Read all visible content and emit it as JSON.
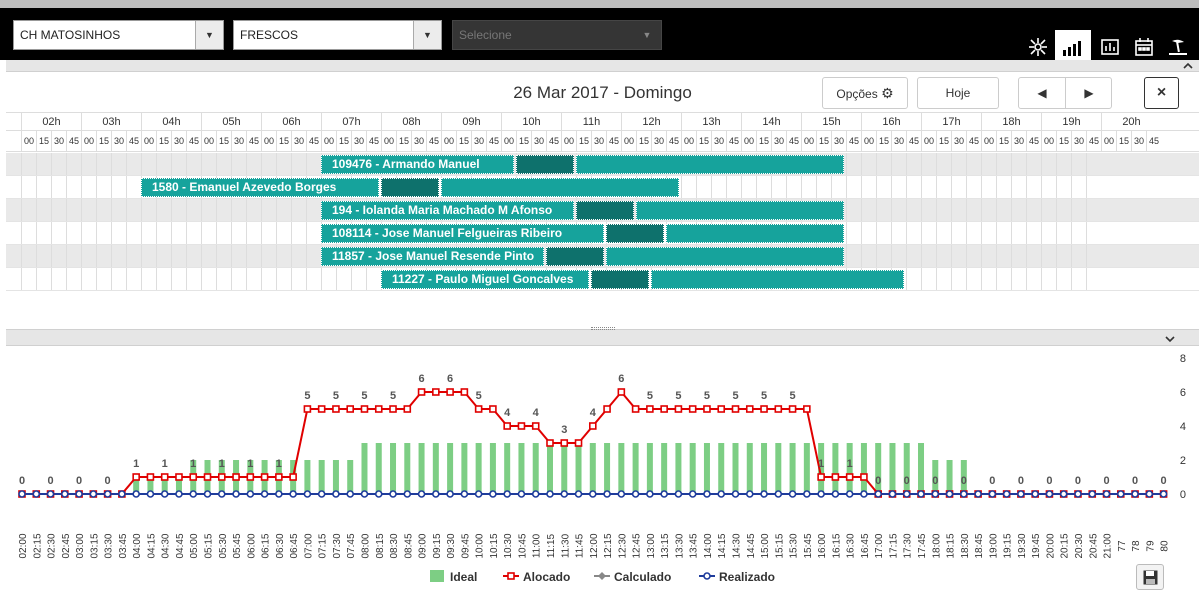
{
  "filters": {
    "store": "CH MATOSINHOS",
    "section": "FRESCOS",
    "third_placeholder": "Selecione"
  },
  "view_icons": [
    "network-icon",
    "bar-chart-icon",
    "column-chart-icon",
    "calendar-icon",
    "vacation-icon"
  ],
  "date_title": "26 Mar 2017 - Domingo",
  "buttons": {
    "options": "Opções",
    "today": "Hoje",
    "prev": "◀",
    "next": "▶",
    "close": "×"
  },
  "hours": [
    "02h",
    "03h",
    "04h",
    "05h",
    "06h",
    "07h",
    "08h",
    "09h",
    "10h",
    "11h",
    "12h",
    "13h",
    "14h",
    "15h",
    "16h",
    "17h",
    "18h",
    "19h",
    "20h"
  ],
  "quarter_marks": [
    "00",
    "15",
    "30",
    "45"
  ],
  "gantt": [
    {
      "label": "109476 - Armando Manuel",
      "segments": [
        [
          "07:00",
          "10:15",
          "work"
        ],
        [
          "10:15",
          "11:15",
          "break"
        ],
        [
          "11:15",
          "15:45",
          "work"
        ]
      ]
    },
    {
      "label": "1580 - Emanuel Azevedo Borges",
      "segments": [
        [
          "04:00",
          "08:00",
          "work"
        ],
        [
          "08:00",
          "09:00",
          "break"
        ],
        [
          "09:00",
          "13:00",
          "work"
        ]
      ]
    },
    {
      "label": "194 - Iolanda Maria Machado M Afonso",
      "segments": [
        [
          "07:00",
          "11:15",
          "work"
        ],
        [
          "11:15",
          "12:15",
          "break"
        ],
        [
          "12:15",
          "15:45",
          "work"
        ]
      ]
    },
    {
      "label": "108114 - Jose Manuel Felgueiras Ribeiro",
      "segments": [
        [
          "07:00",
          "11:45",
          "work"
        ],
        [
          "11:45",
          "12:45",
          "break"
        ],
        [
          "12:45",
          "15:45",
          "work"
        ]
      ]
    },
    {
      "label": "11857 - Jose Manuel Resende Pinto",
      "segments": [
        [
          "07:00",
          "10:45",
          "work"
        ],
        [
          "10:45",
          "11:45",
          "break"
        ],
        [
          "11:45",
          "15:45",
          "work"
        ]
      ]
    },
    {
      "label": "11227 - Paulo Miguel Goncalves",
      "segments": [
        [
          "08:00",
          "11:30",
          "work"
        ],
        [
          "11:30",
          "12:30",
          "break"
        ],
        [
          "12:30",
          "16:45",
          "work"
        ]
      ]
    }
  ],
  "chart_data": {
    "type": "bar",
    "categories": [
      "02:00",
      "02:15",
      "02:30",
      "02:45",
      "03:00",
      "03:15",
      "03:30",
      "03:45",
      "04:00",
      "04:15",
      "04:30",
      "04:45",
      "05:00",
      "05:15",
      "05:30",
      "05:45",
      "06:00",
      "06:15",
      "06:30",
      "06:45",
      "07:00",
      "07:15",
      "07:30",
      "07:45",
      "08:00",
      "08:15",
      "08:30",
      "08:45",
      "09:00",
      "09:15",
      "09:30",
      "09:45",
      "10:00",
      "10:15",
      "10:30",
      "10:45",
      "11:00",
      "11:15",
      "11:30",
      "11:45",
      "12:00",
      "12:15",
      "12:30",
      "12:45",
      "13:00",
      "13:15",
      "13:30",
      "13:45",
      "14:00",
      "14:15",
      "14:30",
      "14:45",
      "15:00",
      "15:15",
      "15:30",
      "15:45",
      "16:00",
      "16:15",
      "16:30",
      "16:45",
      "17:00",
      "17:15",
      "17:30",
      "17:45",
      "18:00",
      "18:15",
      "18:30",
      "18:45",
      "19:00",
      "19:15",
      "19:30",
      "19:45",
      "20:00",
      "20:15",
      "20:30",
      "20:45",
      "21:00",
      "77",
      "78",
      "79",
      "80"
    ],
    "series": [
      {
        "name": "Ideal",
        "kind": "bar",
        "color": "#7dce84",
        "values": [
          0,
          0,
          0,
          0,
          0,
          0,
          0,
          0,
          1,
          1,
          1,
          1,
          2,
          2,
          2,
          2,
          2,
          2,
          2,
          2,
          2,
          2,
          2,
          2,
          3,
          3,
          3,
          3,
          3,
          3,
          3,
          3,
          3,
          3,
          3,
          3,
          3,
          3,
          3,
          3,
          3,
          3,
          3,
          3,
          3,
          3,
          3,
          3,
          3,
          3,
          3,
          3,
          3,
          3,
          3,
          3,
          3,
          3,
          3,
          3,
          3,
          3,
          3,
          3,
          2,
          2,
          2,
          0,
          0,
          0,
          0,
          0,
          0,
          0,
          0,
          0,
          0,
          0,
          0,
          0,
          0
        ]
      },
      {
        "name": "Alocado",
        "kind": "line",
        "color": "#e00000",
        "values": [
          0,
          0,
          0,
          0,
          0,
          0,
          0,
          0,
          1,
          1,
          1,
          1,
          1,
          1,
          1,
          1,
          1,
          1,
          1,
          1,
          5,
          5,
          5,
          5,
          5,
          5,
          5,
          5,
          6,
          6,
          6,
          6,
          5,
          5,
          4,
          4,
          4,
          3,
          3,
          3,
          4,
          5,
          6,
          5,
          5,
          5,
          5,
          5,
          5,
          5,
          5,
          5,
          5,
          5,
          5,
          5,
          1,
          1,
          1,
          1,
          0,
          0,
          0,
          0,
          0,
          0,
          0,
          0,
          0,
          0,
          0,
          0,
          0,
          0,
          0,
          0,
          0,
          0,
          0,
          0,
          0
        ]
      },
      {
        "name": "Calculado",
        "kind": "line",
        "color": "#888888",
        "values": [
          0,
          0,
          0,
          0,
          0,
          0,
          0,
          0,
          0,
          0,
          0,
          0,
          0,
          0,
          0,
          0,
          0,
          0,
          0,
          0,
          0,
          0,
          0,
          0,
          0,
          0,
          0,
          0,
          0,
          0,
          0,
          0,
          0,
          0,
          0,
          0,
          0,
          0,
          0,
          0,
          0,
          0,
          0,
          0,
          0,
          0,
          0,
          0,
          0,
          0,
          0,
          0,
          0,
          0,
          0,
          0,
          0,
          0,
          0,
          0,
          0,
          0,
          0,
          0,
          0,
          0,
          0,
          0,
          0,
          0,
          0,
          0,
          0,
          0,
          0,
          0,
          0,
          0,
          0,
          0,
          0
        ]
      },
      {
        "name": "Realizado",
        "kind": "line",
        "color": "#1f3c9c",
        "values": [
          0,
          0,
          0,
          0,
          0,
          0,
          0,
          0,
          0,
          0,
          0,
          0,
          0,
          0,
          0,
          0,
          0,
          0,
          0,
          0,
          0,
          0,
          0,
          0,
          0,
          0,
          0,
          0,
          0,
          0,
          0,
          0,
          0,
          0,
          0,
          0,
          0,
          0,
          0,
          0,
          0,
          0,
          0,
          0,
          0,
          0,
          0,
          0,
          0,
          0,
          0,
          0,
          0,
          0,
          0,
          0,
          0,
          0,
          0,
          0,
          0,
          0,
          0,
          0,
          0,
          0,
          0,
          0,
          0,
          0,
          0,
          0,
          0,
          0,
          0,
          0,
          0,
          0,
          0,
          0,
          0
        ]
      }
    ],
    "yticks": [
      0,
      2,
      4,
      6,
      8
    ],
    "ylim": [
      0,
      8
    ],
    "legend_position": "bottom"
  },
  "legend": {
    "ideal": "Ideal",
    "alocado": "Alocado",
    "calculado": "Calculado",
    "realizado": "Realizado"
  }
}
